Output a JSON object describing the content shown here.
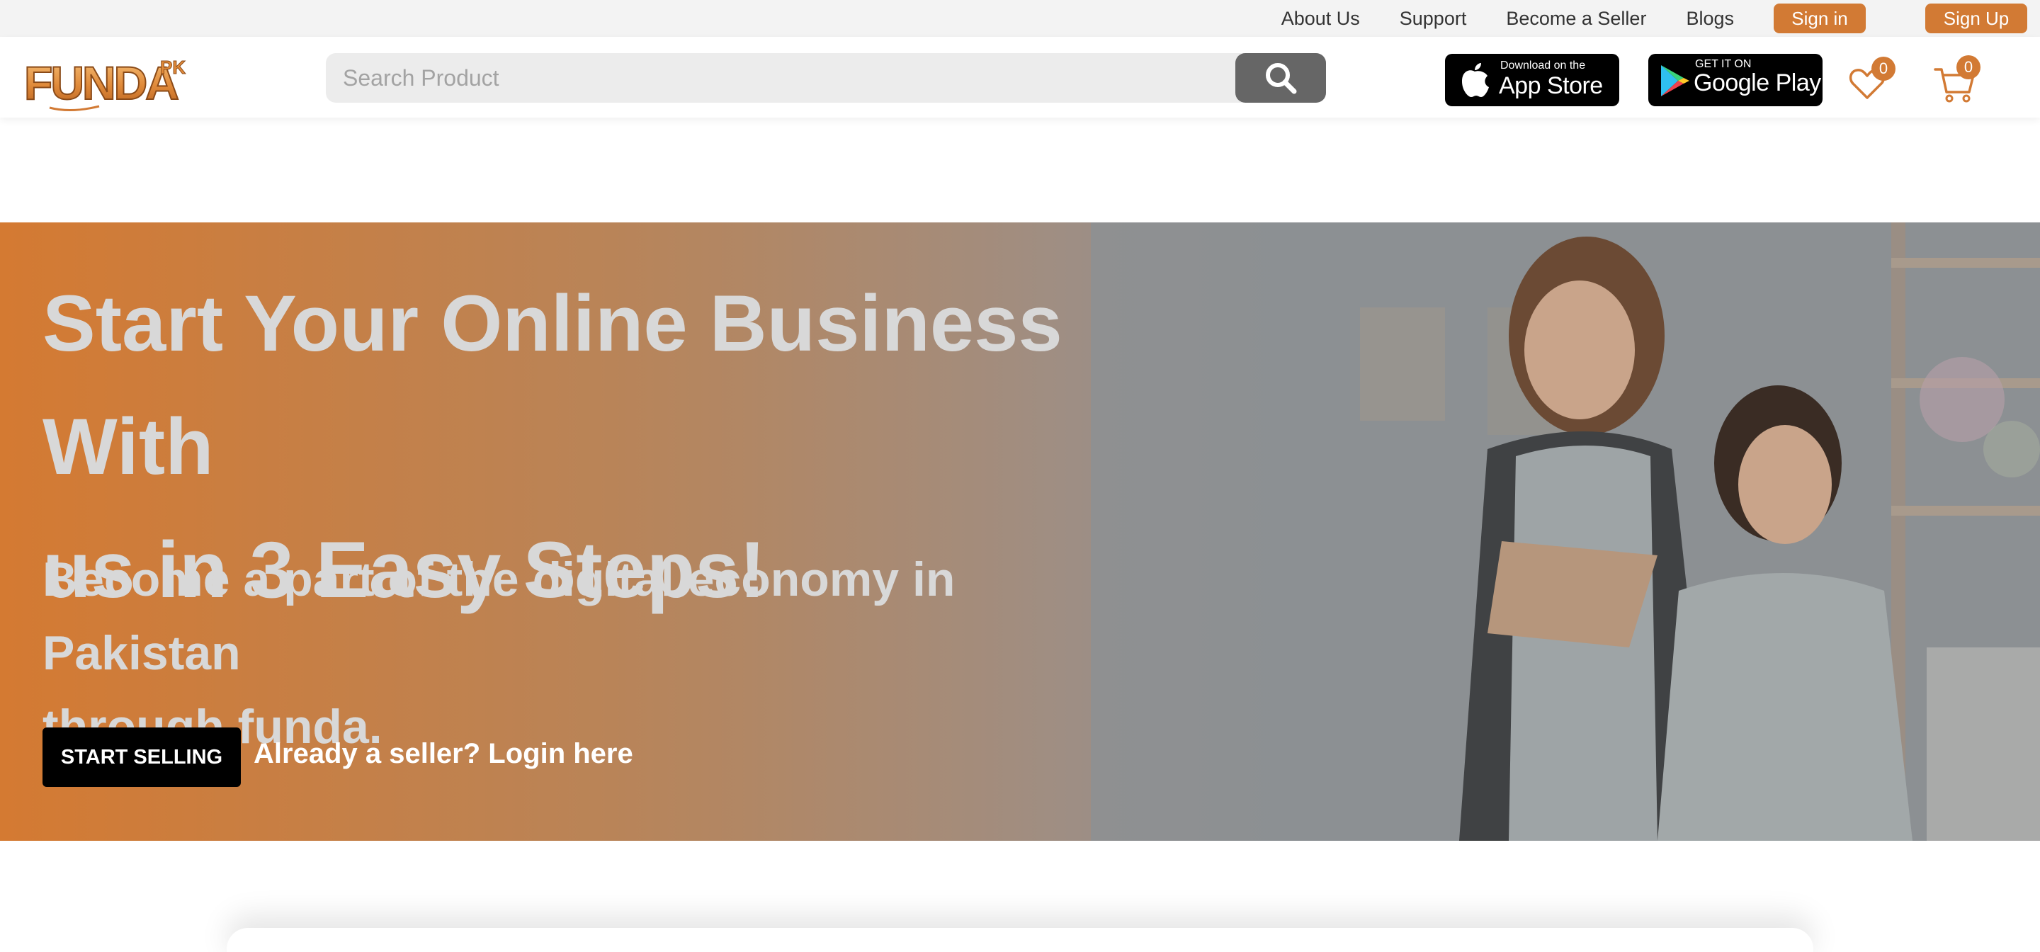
{
  "topbar": {
    "links": {
      "about": "About Us",
      "support": "Support",
      "become_seller": "Become a Seller",
      "blogs": "Blogs"
    },
    "sign_in": "Sign in",
    "sign_up": "Sign Up"
  },
  "header": {
    "logo_text": "FUNDA",
    "logo_suffix": "PK",
    "search": {
      "placeholder": "Search Product",
      "value": ""
    },
    "app_store": {
      "small": "Download on the",
      "large": "App Store"
    },
    "google_play": {
      "small": "GET IT ON",
      "large": "Google Play"
    },
    "wishlist_count": "0",
    "cart_count": "0"
  },
  "hero": {
    "title_line1": "Start Your Online Business With",
    "title_line2": "us in 3 Easy Steps!",
    "subtitle_line1": "Become a part of the digital economy in Pakistan",
    "subtitle_line2": "through funda.",
    "cta": "START SELLING",
    "login_link": "Already a seller? Login here"
  },
  "colors": {
    "accent": "#d27a34",
    "search_button": "#666666",
    "hero_text": "#d8d8d8"
  },
  "icons": [
    "search-icon",
    "apple-icon",
    "google-play-icon",
    "heart-icon",
    "cart-icon"
  ]
}
